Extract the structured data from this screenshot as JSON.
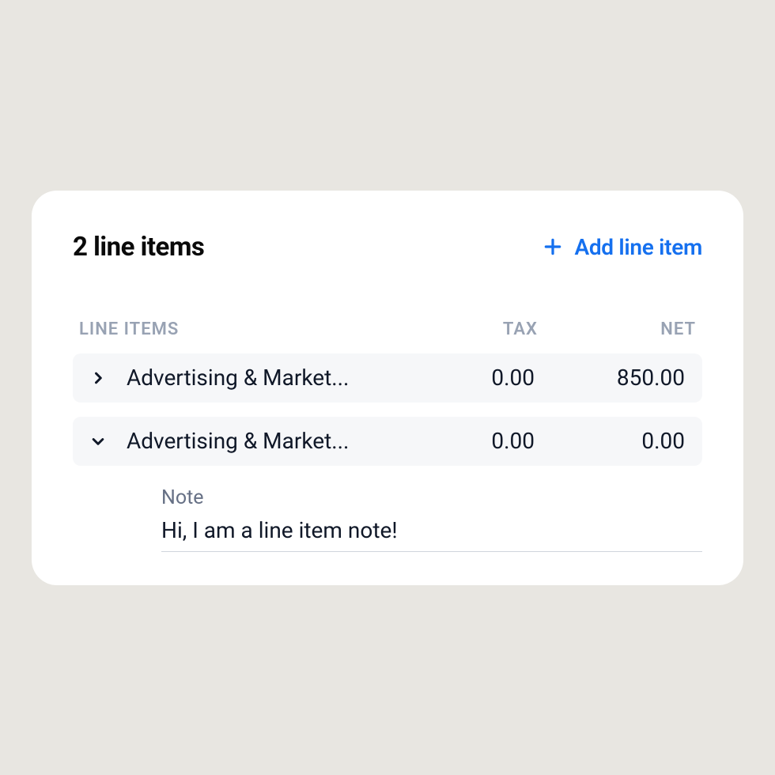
{
  "header": {
    "title": "2 line items",
    "add_label": "Add line item"
  },
  "columns": {
    "items": "LINE ITEMS",
    "tax": "TAX",
    "net": "NET"
  },
  "rows": [
    {
      "name": "Advertising & Market...",
      "tax": "0.00",
      "net": "850.00",
      "expanded": false
    },
    {
      "name": "Advertising & Market...",
      "tax": "0.00",
      "net": "0.00",
      "expanded": true
    }
  ],
  "note": {
    "label": "Note",
    "text": "Hi, I am a line item note!"
  }
}
